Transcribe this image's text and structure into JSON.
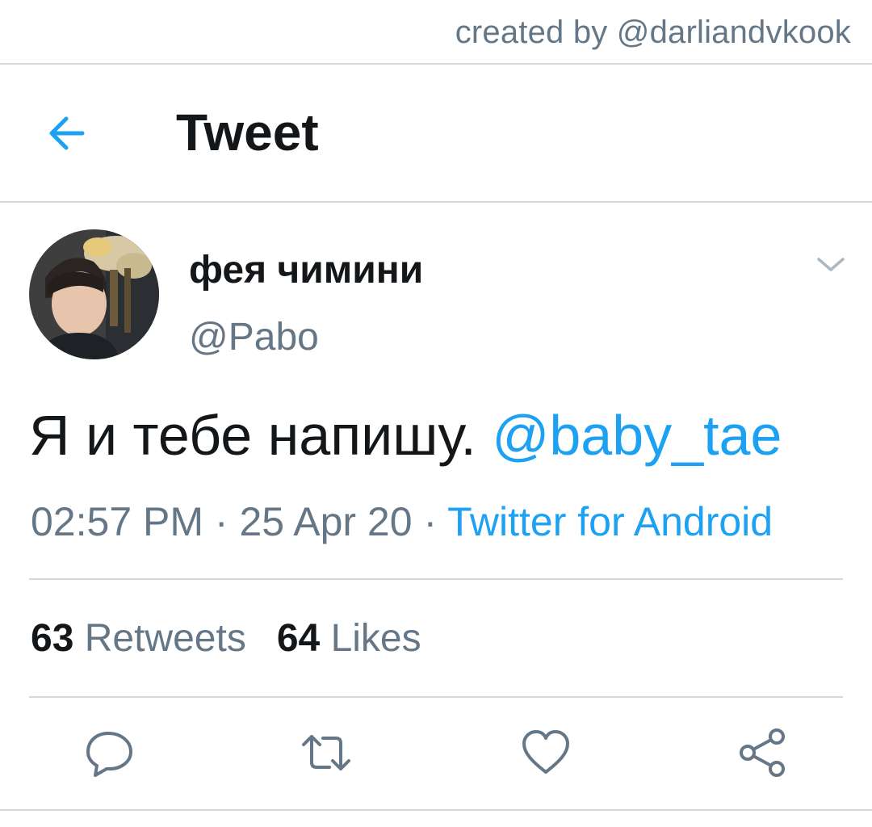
{
  "credit": "created by @darliandvkook",
  "header": {
    "title": "Tweet",
    "back_icon": "arrow-left-icon"
  },
  "tweet": {
    "display_name": "фея чимини",
    "handle": "@Pabo",
    "text": "Я и тебе напишу.",
    "mention": "@baby_tae",
    "time": "02:57 PM",
    "separator": "·",
    "date": "25 Apr 20",
    "source": "Twitter for Android"
  },
  "stats": {
    "retweets_count": "63",
    "retweets_label": "Retweets",
    "likes_count": "64",
    "likes_label": "Likes"
  },
  "actions": [
    "reply-icon",
    "retweet-icon",
    "like-icon",
    "share-icon"
  ],
  "colors": {
    "accent": "#1da1f2",
    "text": "#14171a",
    "muted": "#657786",
    "divider": "#d3d9de"
  }
}
